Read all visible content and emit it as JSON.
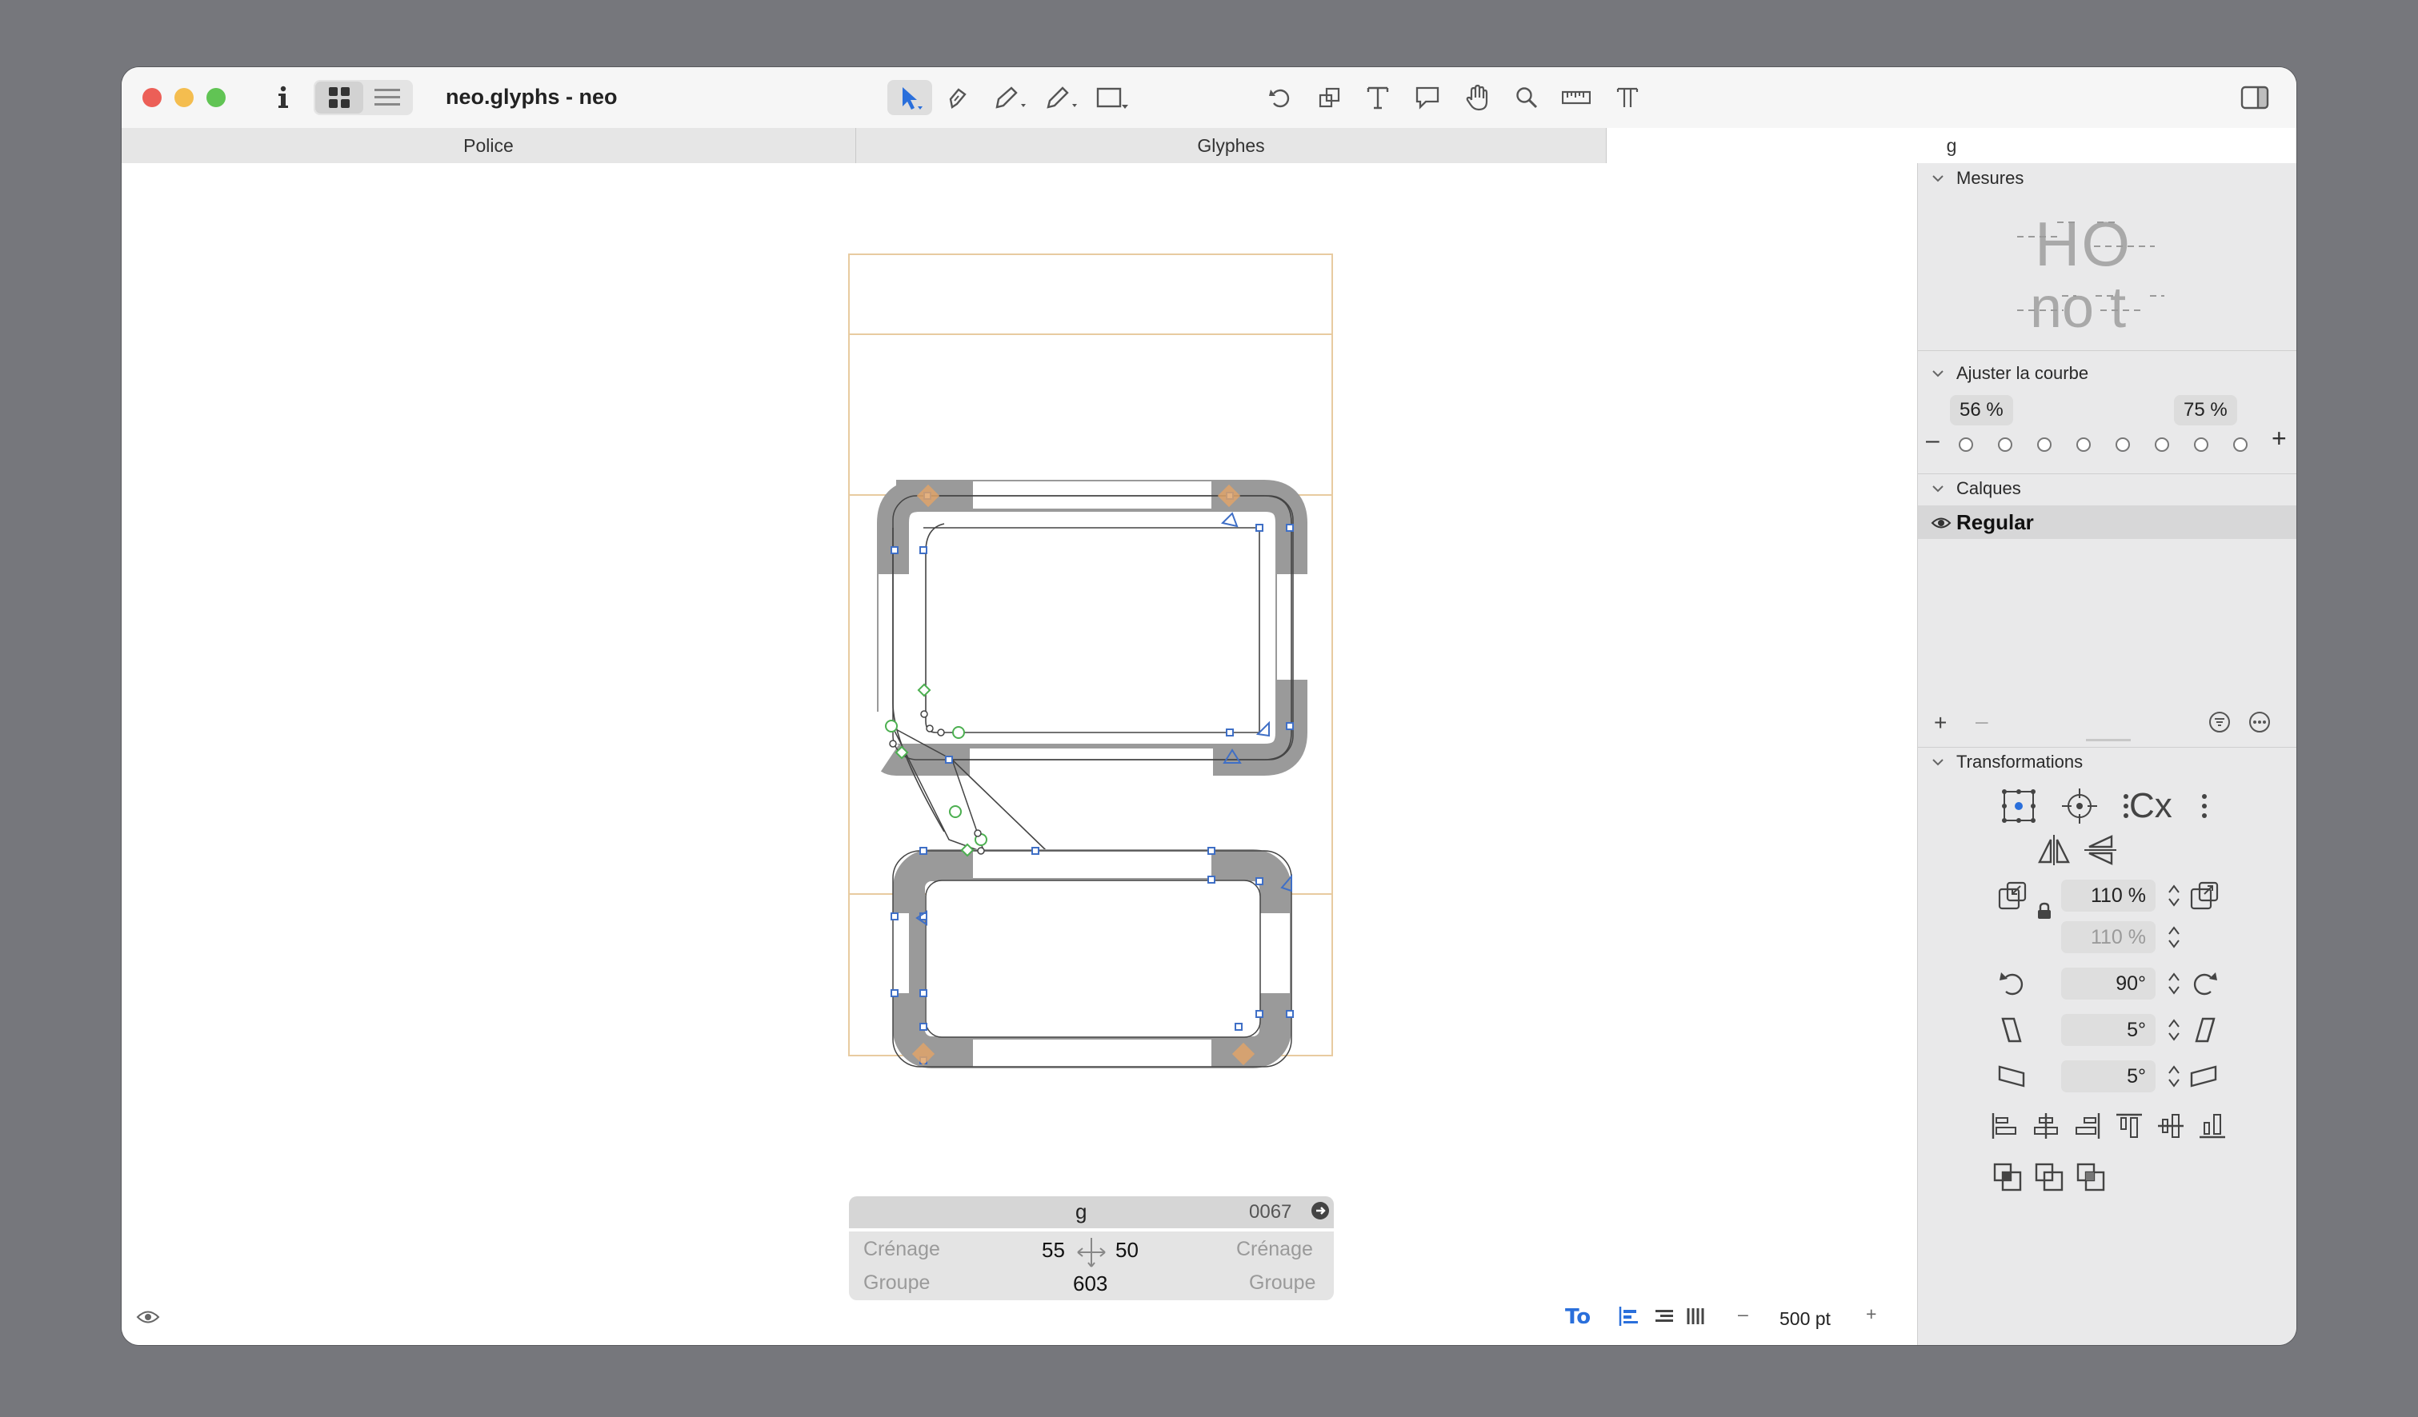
{
  "window": {
    "title": "neo.glyphs - neo"
  },
  "tabs": [
    {
      "label": "Police"
    },
    {
      "label": "Glyphes"
    },
    {
      "label": "g"
    }
  ],
  "toolbar": {
    "info_icon": "info-icon",
    "view_modes": [
      "grid-view-icon",
      "list-view-icon"
    ],
    "tools": [
      "select-tool-icon",
      "pen-edit-icon",
      "draw-tool-icon",
      "pencil-tool-icon",
      "rectangle-tool-icon",
      "rotate-tool-icon",
      "scale-tool-icon",
      "text-tool-icon",
      "annotation-tool-icon",
      "hand-tool-icon",
      "zoom-tool-icon",
      "measure-tool-icon",
      "type-tool-icon"
    ],
    "sidebar_toggle": "sidebar-toggle-icon"
  },
  "panel": {
    "metrics": {
      "title": "Mesures",
      "preview_top": "HO",
      "preview_bottom": "no t"
    },
    "curve": {
      "title": "Ajuster la courbe",
      "left_value": "56 %",
      "right_value": "75 %",
      "minus": "–",
      "plus": "+"
    },
    "layers": {
      "title": "Calques",
      "items": [
        {
          "name": "Regular",
          "visible": true
        }
      ],
      "add": "+",
      "remove": "–"
    },
    "transforms": {
      "title": "Transformations",
      "scale_x": "110 %",
      "scale_y": "110 %",
      "rotate": "90°",
      "slant_x": "5°",
      "slant_y": "5°"
    }
  },
  "glyph_info": {
    "name": "g",
    "unicode": "0067",
    "kerning_label_left": "Crénage",
    "kerning_label_right": "Crénage",
    "group_label_left": "Groupe",
    "group_label_right": "Groupe",
    "lsb": "55",
    "rsb": "50",
    "width": "603"
  },
  "bottom_bar": {
    "zoom": "500 pt",
    "minus": "–",
    "plus": "+",
    "preview_label": "To"
  },
  "colors": {
    "accent": "#2a6fdb",
    "outline_fill": "#9a9a9a",
    "metric_line": "#e8cba0",
    "node_blue": "#3f6fc6",
    "node_green": "#4caf50",
    "anchor": "#e0a36a"
  }
}
